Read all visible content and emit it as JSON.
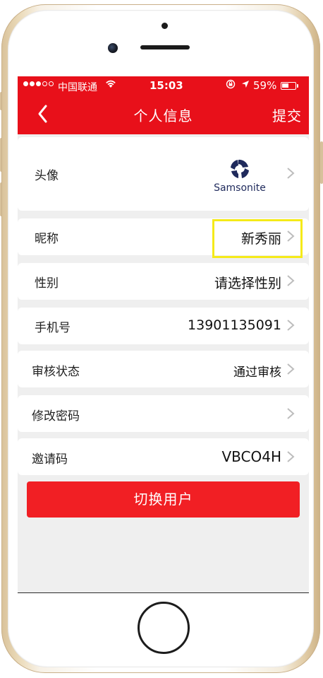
{
  "status_bar": {
    "carrier": "中国联通",
    "time": "15:03",
    "battery": "59%",
    "battery_level": 0.59,
    "signal_bars_filled": 3,
    "signal_bars_total": 5
  },
  "nav": {
    "back_icon": "chevron-left-icon",
    "title": "个人信息",
    "submit_label": "提交"
  },
  "profile": {
    "avatar_label": "头像",
    "avatar_brand": "Samsonite",
    "nickname_label": "昵称",
    "nickname_value": "新秀丽",
    "gender_label": "性别",
    "gender_value": "请选择性别",
    "phone_label": "手机号",
    "phone_value": "13901135091",
    "review_label": "审核状态",
    "review_value": "通过审核",
    "password_label": "修改密码",
    "invite_label": "邀请码",
    "invite_value": "VBCO4H"
  },
  "actions": {
    "switch_user_label": "切换用户"
  },
  "colors": {
    "brand_red": "#e8101a",
    "button_red": "#f11f24",
    "highlight_yellow": "#f5ea19",
    "samsonite_navy": "#1f2a5c"
  }
}
